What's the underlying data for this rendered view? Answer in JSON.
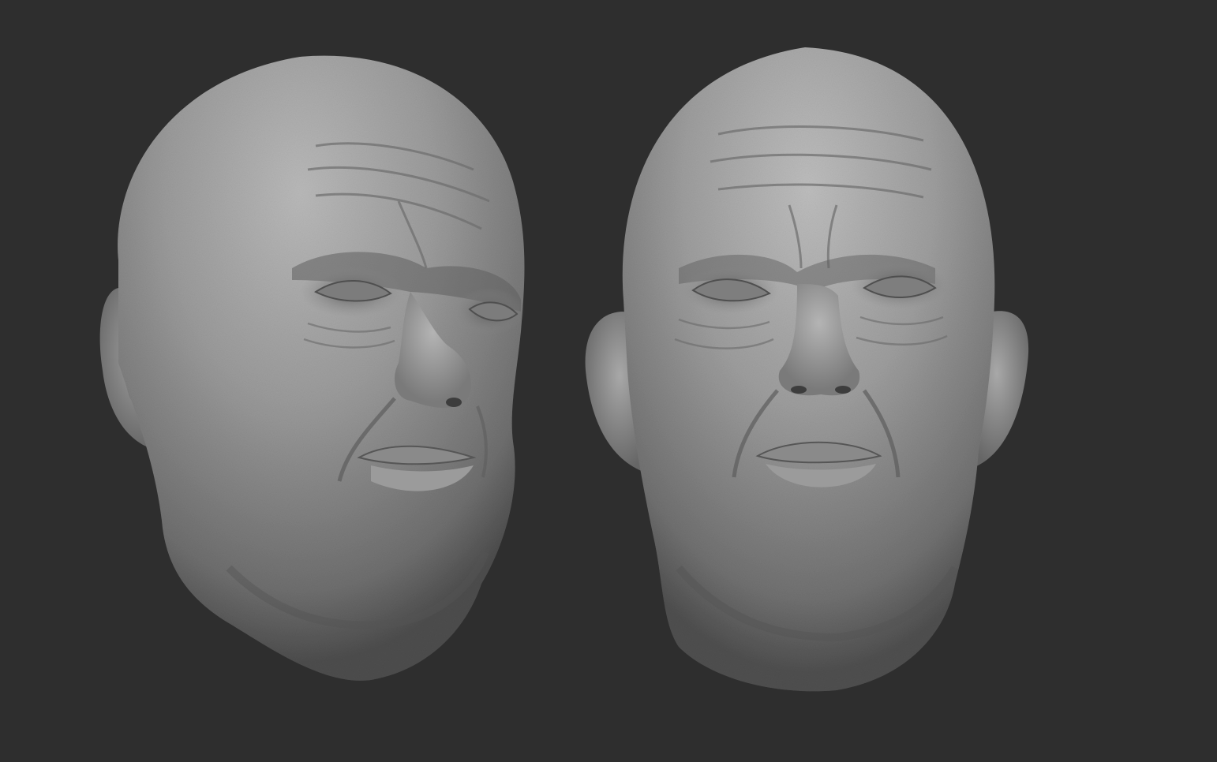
{
  "scene": {
    "background_color": "#2e2e2e",
    "material_color": "#8c8c8c",
    "objects": [
      {
        "name": "head-three-quarter-view",
        "view": "three-quarter"
      },
      {
        "name": "head-front-view",
        "view": "front"
      }
    ]
  }
}
